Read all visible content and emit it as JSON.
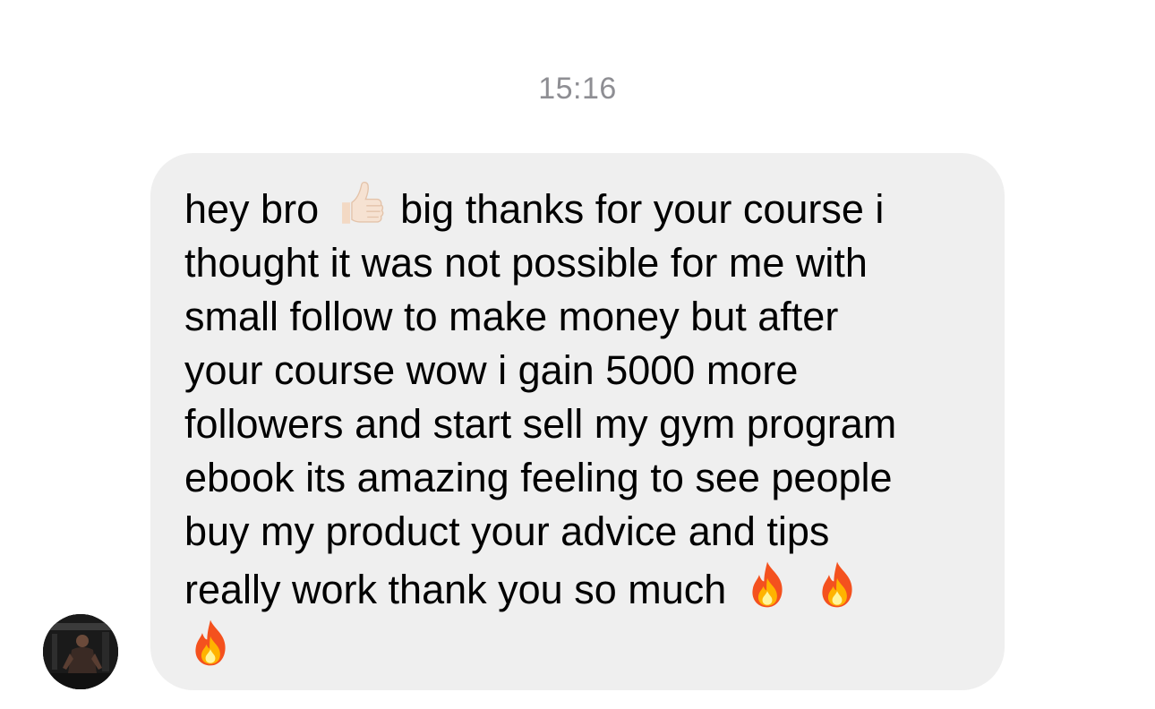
{
  "conversation": {
    "timestamp": "15:16"
  },
  "message": {
    "sender_avatar": "profile-photo",
    "lines": [
      {
        "before": "hey bro",
        "emoji": "thumbs-up",
        "after": "big thanks for your course i"
      },
      {
        "text": "thought it was not possible for me with"
      },
      {
        "text": "small follow to make money but after"
      },
      {
        "text": "your course wow i gain 5000 more"
      },
      {
        "text": "followers and start sell my gym program"
      },
      {
        "text": "ebook its amazing feeling to see people"
      },
      {
        "text": "buy my product your advice and tips"
      },
      {
        "text": "really work thank you so much"
      }
    ],
    "trailing_emojis": [
      "fire",
      "fire",
      "fire"
    ]
  },
  "colors": {
    "bubble_bg": "#efefef",
    "timestamp": "#8e8e93",
    "text": "#000000"
  }
}
